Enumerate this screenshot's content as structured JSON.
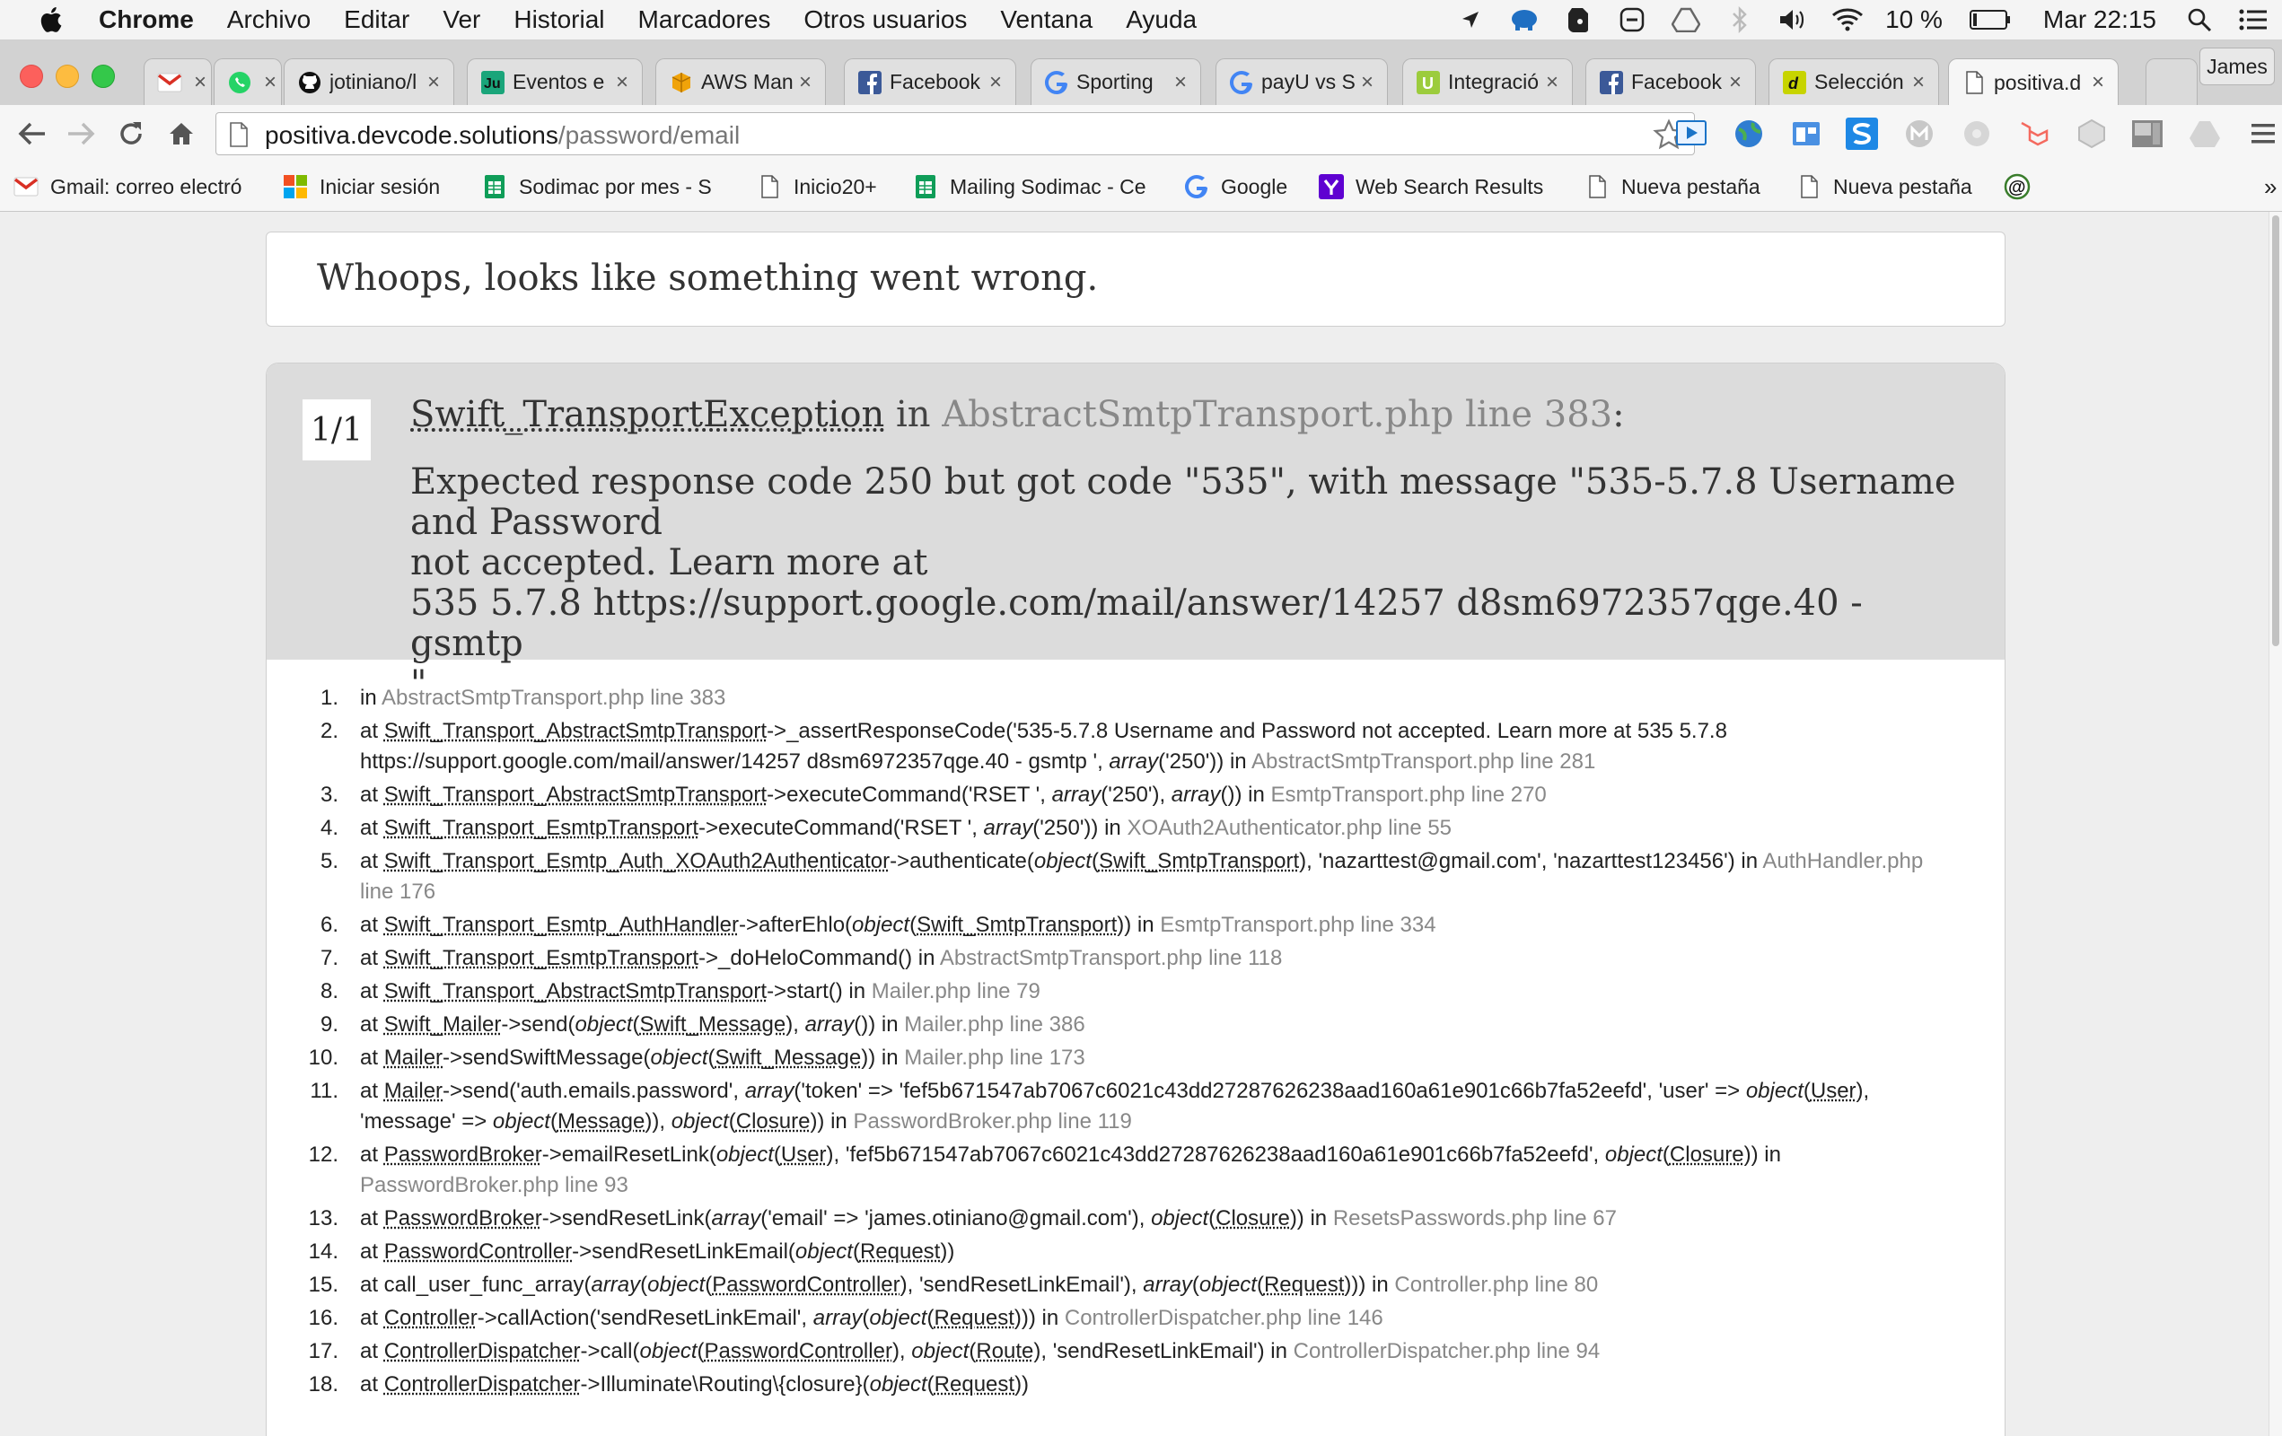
{
  "menubar": {
    "app": "Chrome",
    "items": [
      "Archivo",
      "Editar",
      "Ver",
      "Historial",
      "Marcadores",
      "Otros usuarios",
      "Ventana",
      "Ayuda"
    ],
    "battery": "10 %",
    "clock": "Mar 22:15"
  },
  "tabs": [
    {
      "title": "",
      "icon": "gmail-icon"
    },
    {
      "title": "",
      "icon": "whatsapp-icon"
    },
    {
      "title": "jotiniano/l",
      "icon": "github-icon"
    },
    {
      "title": "Eventos e",
      "icon": "ju-icon"
    },
    {
      "title": "AWS Man",
      "icon": "aws-icon"
    },
    {
      "title": "Facebook",
      "icon": "facebook-icon"
    },
    {
      "title": "Sporting",
      "icon": "google-icon"
    },
    {
      "title": "payU vs S",
      "icon": "google-icon"
    },
    {
      "title": "Integració",
      "icon": "u-icon"
    },
    {
      "title": "Facebook",
      "icon": "facebook-icon"
    },
    {
      "title": "Selección",
      "icon": "d-icon"
    },
    {
      "title": "positiva.d",
      "icon": "page-icon",
      "active": true
    }
  ],
  "profile": "James",
  "address": {
    "host": "positiva.devcode.solutions",
    "path": "/password/email"
  },
  "bookmarks": [
    {
      "label": "Gmail: correo electró",
      "icon": "gmail-icon"
    },
    {
      "label": "Iniciar sesión",
      "icon": "microsoft-icon"
    },
    {
      "label": "Sodimac por mes - S",
      "icon": "sheets-icon"
    },
    {
      "label": "Inicio20+",
      "icon": "page-icon"
    },
    {
      "label": "Mailing Sodimac - Ce",
      "icon": "sheets-icon"
    },
    {
      "label": "Google",
      "icon": "google-icon"
    },
    {
      "label": "Web Search Results",
      "icon": "yahoo-icon"
    },
    {
      "label": "Nueva pestaña",
      "icon": "page-icon"
    },
    {
      "label": "Nueva pestaña",
      "icon": "page-icon"
    },
    {
      "label": "",
      "icon": "at-icon"
    }
  ],
  "error": {
    "heading": "Whoops, looks like something went wrong.",
    "counter": "1/1",
    "exception_class": "Swift_TransportException",
    "in_word": " in ",
    "location": "AbstractSmtpTransport.php line 383",
    "colon": ":",
    "message": "Expected response code 250 but got code \"535\", with message \"535-5.7.8 Username and Password\nnot accepted. Learn more at\n535 5.7.8 https://support.google.com/mail/answer/14257 d8sm6972357qge.40 - gsmtp\n\""
  },
  "trace": [
    [
      {
        "t": "in "
      },
      {
        "t": "AbstractSmtpTransport.php line 383",
        "s": "loc"
      }
    ],
    [
      {
        "t": "at "
      },
      {
        "t": "Swift_Transport_AbstractSmtpTransport",
        "s": "cls"
      },
      {
        "t": "->_assertResponseCode('535-5.7.8 Username and Password not accepted. Learn more at 535 5.7.8 https://support.google.com/mail/answer/14257 d8sm6972357qge.40 - gsmtp ', "
      },
      {
        "t": "array",
        "s": "it"
      },
      {
        "t": "('250')) in "
      },
      {
        "t": "AbstractSmtpTransport.php line 281",
        "s": "loc"
      }
    ],
    [
      {
        "t": "at "
      },
      {
        "t": "Swift_Transport_AbstractSmtpTransport",
        "s": "cls"
      },
      {
        "t": "->executeCommand('RSET ', "
      },
      {
        "t": "array",
        "s": "it"
      },
      {
        "t": "('250'), "
      },
      {
        "t": "array",
        "s": "it"
      },
      {
        "t": "()) in "
      },
      {
        "t": "EsmtpTransport.php line 270",
        "s": "loc"
      }
    ],
    [
      {
        "t": "at "
      },
      {
        "t": "Swift_Transport_EsmtpTransport",
        "s": "cls"
      },
      {
        "t": "->executeCommand('RSET ', "
      },
      {
        "t": "array",
        "s": "it"
      },
      {
        "t": "('250')) in "
      },
      {
        "t": "XOAuth2Authenticator.php line 55",
        "s": "loc"
      }
    ],
    [
      {
        "t": "at "
      },
      {
        "t": "Swift_Transport_Esmtp_Auth_XOAuth2Authenticator",
        "s": "cls"
      },
      {
        "t": "->authenticate("
      },
      {
        "t": "object",
        "s": "it"
      },
      {
        "t": "("
      },
      {
        "t": "Swift_SmtpTransport",
        "s": "cls"
      },
      {
        "t": "), 'nazarttest@gmail.com', 'nazarttest123456') in "
      },
      {
        "t": "AuthHandler.php line 176",
        "s": "loc"
      }
    ],
    [
      {
        "t": "at "
      },
      {
        "t": "Swift_Transport_Esmtp_AuthHandler",
        "s": "cls"
      },
      {
        "t": "->afterEhlo("
      },
      {
        "t": "object",
        "s": "it"
      },
      {
        "t": "("
      },
      {
        "t": "Swift_SmtpTransport",
        "s": "cls"
      },
      {
        "t": ")) in "
      },
      {
        "t": "EsmtpTransport.php line 334",
        "s": "loc"
      }
    ],
    [
      {
        "t": "at "
      },
      {
        "t": "Swift_Transport_EsmtpTransport",
        "s": "cls"
      },
      {
        "t": "->_doHeloCommand() in "
      },
      {
        "t": "AbstractSmtpTransport.php line 118",
        "s": "loc"
      }
    ],
    [
      {
        "t": "at "
      },
      {
        "t": "Swift_Transport_AbstractSmtpTransport",
        "s": "cls"
      },
      {
        "t": "->start() in "
      },
      {
        "t": "Mailer.php line 79",
        "s": "loc"
      }
    ],
    [
      {
        "t": "at "
      },
      {
        "t": "Swift_Mailer",
        "s": "cls"
      },
      {
        "t": "->send("
      },
      {
        "t": "object",
        "s": "it"
      },
      {
        "t": "("
      },
      {
        "t": "Swift_Message",
        "s": "cls"
      },
      {
        "t": "), "
      },
      {
        "t": "array",
        "s": "it"
      },
      {
        "t": "()) in "
      },
      {
        "t": "Mailer.php line 386",
        "s": "loc"
      }
    ],
    [
      {
        "t": "at "
      },
      {
        "t": "Mailer",
        "s": "cls"
      },
      {
        "t": "->sendSwiftMessage("
      },
      {
        "t": "object",
        "s": "it"
      },
      {
        "t": "("
      },
      {
        "t": "Swift_Message",
        "s": "cls"
      },
      {
        "t": ")) in "
      },
      {
        "t": "Mailer.php line 173",
        "s": "loc"
      }
    ],
    [
      {
        "t": "at "
      },
      {
        "t": "Mailer",
        "s": "cls"
      },
      {
        "t": "->send('auth.emails.password', "
      },
      {
        "t": "array",
        "s": "it"
      },
      {
        "t": "('token' => 'fef5b671547ab7067c6021c43dd27287626238aad160a61e901c66b7fa52eefd', 'user' => "
      },
      {
        "t": "object",
        "s": "it"
      },
      {
        "t": "("
      },
      {
        "t": "User",
        "s": "cls"
      },
      {
        "t": "), 'message' => "
      },
      {
        "t": "object",
        "s": "it"
      },
      {
        "t": "("
      },
      {
        "t": "Message",
        "s": "cls"
      },
      {
        "t": ")), "
      },
      {
        "t": "object",
        "s": "it"
      },
      {
        "t": "("
      },
      {
        "t": "Closure",
        "s": "cls"
      },
      {
        "t": ")) in "
      },
      {
        "t": "PasswordBroker.php line 119",
        "s": "loc"
      }
    ],
    [
      {
        "t": "at "
      },
      {
        "t": "PasswordBroker",
        "s": "cls"
      },
      {
        "t": "->emailResetLink("
      },
      {
        "t": "object",
        "s": "it"
      },
      {
        "t": "("
      },
      {
        "t": "User",
        "s": "cls"
      },
      {
        "t": "), 'fef5b671547ab7067c6021c43dd27287626238aad160a61e901c66b7fa52eefd', "
      },
      {
        "t": "object",
        "s": "it"
      },
      {
        "t": "("
      },
      {
        "t": "Closure",
        "s": "cls"
      },
      {
        "t": ")) in "
      },
      {
        "t": "PasswordBroker.php line 93",
        "s": "loc"
      }
    ],
    [
      {
        "t": "at "
      },
      {
        "t": "PasswordBroker",
        "s": "cls"
      },
      {
        "t": "->sendResetLink("
      },
      {
        "t": "array",
        "s": "it"
      },
      {
        "t": "('email' => 'james.otiniano@gmail.com'), "
      },
      {
        "t": "object",
        "s": "it"
      },
      {
        "t": "("
      },
      {
        "t": "Closure",
        "s": "cls"
      },
      {
        "t": ")) in "
      },
      {
        "t": "ResetsPasswords.php line 67",
        "s": "loc"
      }
    ],
    [
      {
        "t": "at "
      },
      {
        "t": "PasswordController",
        "s": "cls"
      },
      {
        "t": "->sendResetLinkEmail("
      },
      {
        "t": "object",
        "s": "it"
      },
      {
        "t": "("
      },
      {
        "t": "Request",
        "s": "cls"
      },
      {
        "t": "))"
      }
    ],
    [
      {
        "t": "at call_user_func_array("
      },
      {
        "t": "array",
        "s": "it"
      },
      {
        "t": "("
      },
      {
        "t": "object",
        "s": "it"
      },
      {
        "t": "("
      },
      {
        "t": "PasswordController",
        "s": "cls"
      },
      {
        "t": "), 'sendResetLinkEmail'), "
      },
      {
        "t": "array",
        "s": "it"
      },
      {
        "t": "("
      },
      {
        "t": "object",
        "s": "it"
      },
      {
        "t": "("
      },
      {
        "t": "Request",
        "s": "cls"
      },
      {
        "t": "))) in "
      },
      {
        "t": "Controller.php line 80",
        "s": "loc"
      }
    ],
    [
      {
        "t": "at "
      },
      {
        "t": "Controller",
        "s": "cls"
      },
      {
        "t": "->callAction('sendResetLinkEmail', "
      },
      {
        "t": "array",
        "s": "it"
      },
      {
        "t": "("
      },
      {
        "t": "object",
        "s": "it"
      },
      {
        "t": "("
      },
      {
        "t": "Request",
        "s": "cls"
      },
      {
        "t": "))) in "
      },
      {
        "t": "ControllerDispatcher.php line 146",
        "s": "loc"
      }
    ],
    [
      {
        "t": "at "
      },
      {
        "t": "ControllerDispatcher",
        "s": "cls"
      },
      {
        "t": "->call("
      },
      {
        "t": "object",
        "s": "it"
      },
      {
        "t": "("
      },
      {
        "t": "PasswordController",
        "s": "cls"
      },
      {
        "t": "), "
      },
      {
        "t": "object",
        "s": "it"
      },
      {
        "t": "("
      },
      {
        "t": "Route",
        "s": "cls"
      },
      {
        "t": "), 'sendResetLinkEmail') in "
      },
      {
        "t": "ControllerDispatcher.php line 94",
        "s": "loc"
      }
    ],
    [
      {
        "t": "at "
      },
      {
        "t": "ControllerDispatcher",
        "s": "cls"
      },
      {
        "t": "->Illuminate\\Routing\\{closure}("
      },
      {
        "t": "object",
        "s": "it"
      },
      {
        "t": "("
      },
      {
        "t": "Request",
        "s": "cls"
      },
      {
        "t": "))"
      }
    ]
  ]
}
